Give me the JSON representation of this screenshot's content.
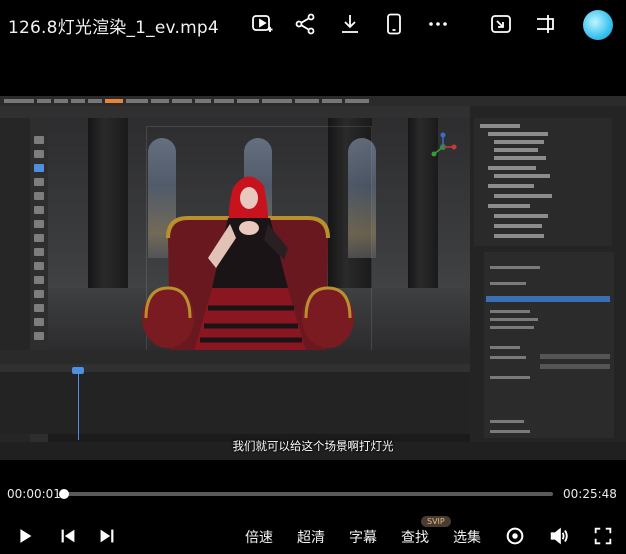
{
  "header": {
    "title": "126.8灯光渲染_1_ev.mp4",
    "icons": [
      "video-play-icon",
      "share-icon",
      "download-icon",
      "phone-icon",
      "more-icon",
      "picture-in-picture-icon",
      "exit-fullscreen-icon",
      "avatar"
    ]
  },
  "video": {
    "subtitle": "我们就可以给这个场景啊打灯光",
    "timeline_frame": "11"
  },
  "player": {
    "current_time": "00:00:01",
    "total_time": "00:25:48",
    "progress": 0.001,
    "speed_label": "倍速",
    "quality_label": "超清",
    "subtitle_label": "字幕",
    "search_label": "查找",
    "search_badge": "SVIP",
    "episodes_label": "选集"
  },
  "colors": {
    "accent": "#ffffff",
    "badge_text": "#e8b98a",
    "timeline_accent": "#4d8fe0"
  }
}
